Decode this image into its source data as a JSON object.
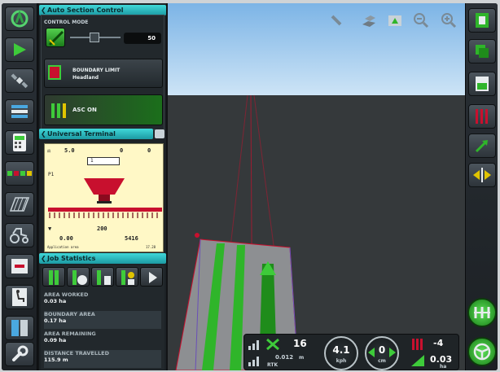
{
  "colors": {
    "accent_teal": "#1fa7b0",
    "active_green": "#2fb52a",
    "sky_blue": "#9cc8ee",
    "ground_gray": "#35393b",
    "terminal_yellow": "#fff8c6",
    "warning_red": "#c8102e"
  },
  "left_sidebar": {
    "icons": [
      "guidance-logo-icon",
      "navigation-arrow-icon",
      "satellite-icon",
      "layers-icon",
      "calculator-icon",
      "boom-sections-icon",
      "field-hatch-icon",
      "tractor-icon",
      "warning-tile-icon",
      "seat-icon",
      "cabinet-icon",
      "wrench-icon"
    ]
  },
  "auto_section_control": {
    "title": "Auto Section Control",
    "control_mode_label": "CONTROL MODE",
    "slider_value": "50",
    "boundary_limit_label": "BOUNDARY LIMIT",
    "boundary_limit_value": "Headland",
    "asc_label": "ASC ON"
  },
  "universal_terminal": {
    "title": "Universal Terminal",
    "line1_value": "5.0",
    "line1_right": "0",
    "line1_mid": "0",
    "field_value": "1",
    "speed_value": "200",
    "bottom_value": "0.00",
    "bottom_right_value": "5416",
    "footer_left": "Application area",
    "footer_right": "17.28"
  },
  "job_statistics": {
    "title": "Job Statistics",
    "rows": [
      {
        "key": "AREA WORKED",
        "value": "0.03 ha"
      },
      {
        "key": "BOUNDARY AREA",
        "value": "0.17 ha"
      },
      {
        "key": "AREA REMAINING",
        "value": "0.09 ha"
      },
      {
        "key": "DISTANCE TRAVELLED",
        "value": "115.9 m"
      }
    ]
  },
  "map_toolbar": {
    "icons": [
      "pin-icon",
      "tile-view-icon",
      "field-view-icon",
      "zoom-out-icon",
      "zoom-in-icon"
    ]
  },
  "status_bar": {
    "satellites": "16",
    "accuracy": "0.012",
    "accuracy_unit": "m",
    "correction": "RTK",
    "speed": "4.1",
    "speed_unit": "kph",
    "offline_distance": "0",
    "offline_unit": "cm",
    "section_value": "-4",
    "rate_value": "0.03",
    "rate_unit": "ha"
  },
  "right_sidebar": {
    "icons": [
      "screen-layout-icon",
      "map-layers-icon",
      "field-layout-icon",
      "red-bars-icon",
      "tracking-arrow-icon",
      "shift-arrows-icon",
      "sections-auto-icon",
      "steering-wheel-icon"
    ]
  }
}
